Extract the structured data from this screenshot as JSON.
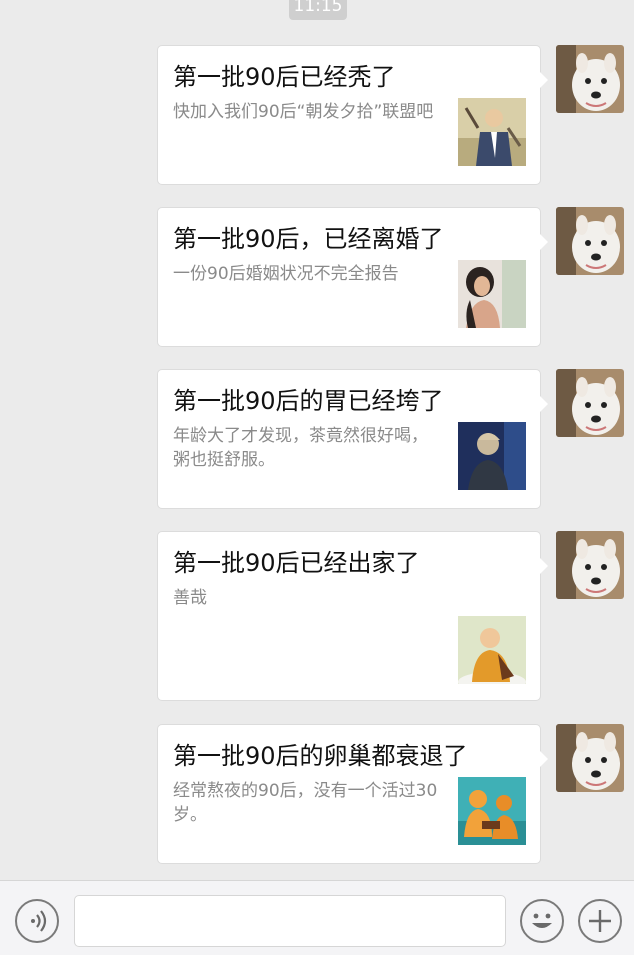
{
  "status": {
    "time": "11:15"
  },
  "messages": [
    {
      "title": "第一批90后已经秃了",
      "desc": "快加入我们90后“朝发夕拾”联盟吧",
      "thumb_icon": "cartoon-man-thumbnail"
    },
    {
      "title": "第一批90后，已经离婚了",
      "desc": "一份90后婚姻状况不完全报告",
      "thumb_icon": "woman-portrait-thumbnail"
    },
    {
      "title": "第一批90后的胃已经垮了",
      "desc": "年龄大了才发现，茶竟然很好喝，粥也挺舒服。",
      "thumb_icon": "man-silhouette-thumbnail"
    },
    {
      "title": "第一批90后已经出家了",
      "desc": "善哉",
      "thumb_icon": "monk-thumbnail"
    },
    {
      "title": "第一批90后的卵巢都衰退了",
      "desc": "经常熬夜的90后，没有一个活过30岁。",
      "thumb_icon": "cartoon-figures-thumbnail"
    }
  ],
  "avatar": {
    "icon": "dog-avatar"
  },
  "toolbar": {
    "voice_icon": "voice-icon",
    "emoji_icon": "emoji-icon",
    "plus_icon": "plus-icon",
    "input_value": ""
  },
  "colors": {
    "background": "#ebebeb",
    "card": "#ffffff",
    "title_text": "#111111",
    "desc_text": "#8a8a8a"
  }
}
